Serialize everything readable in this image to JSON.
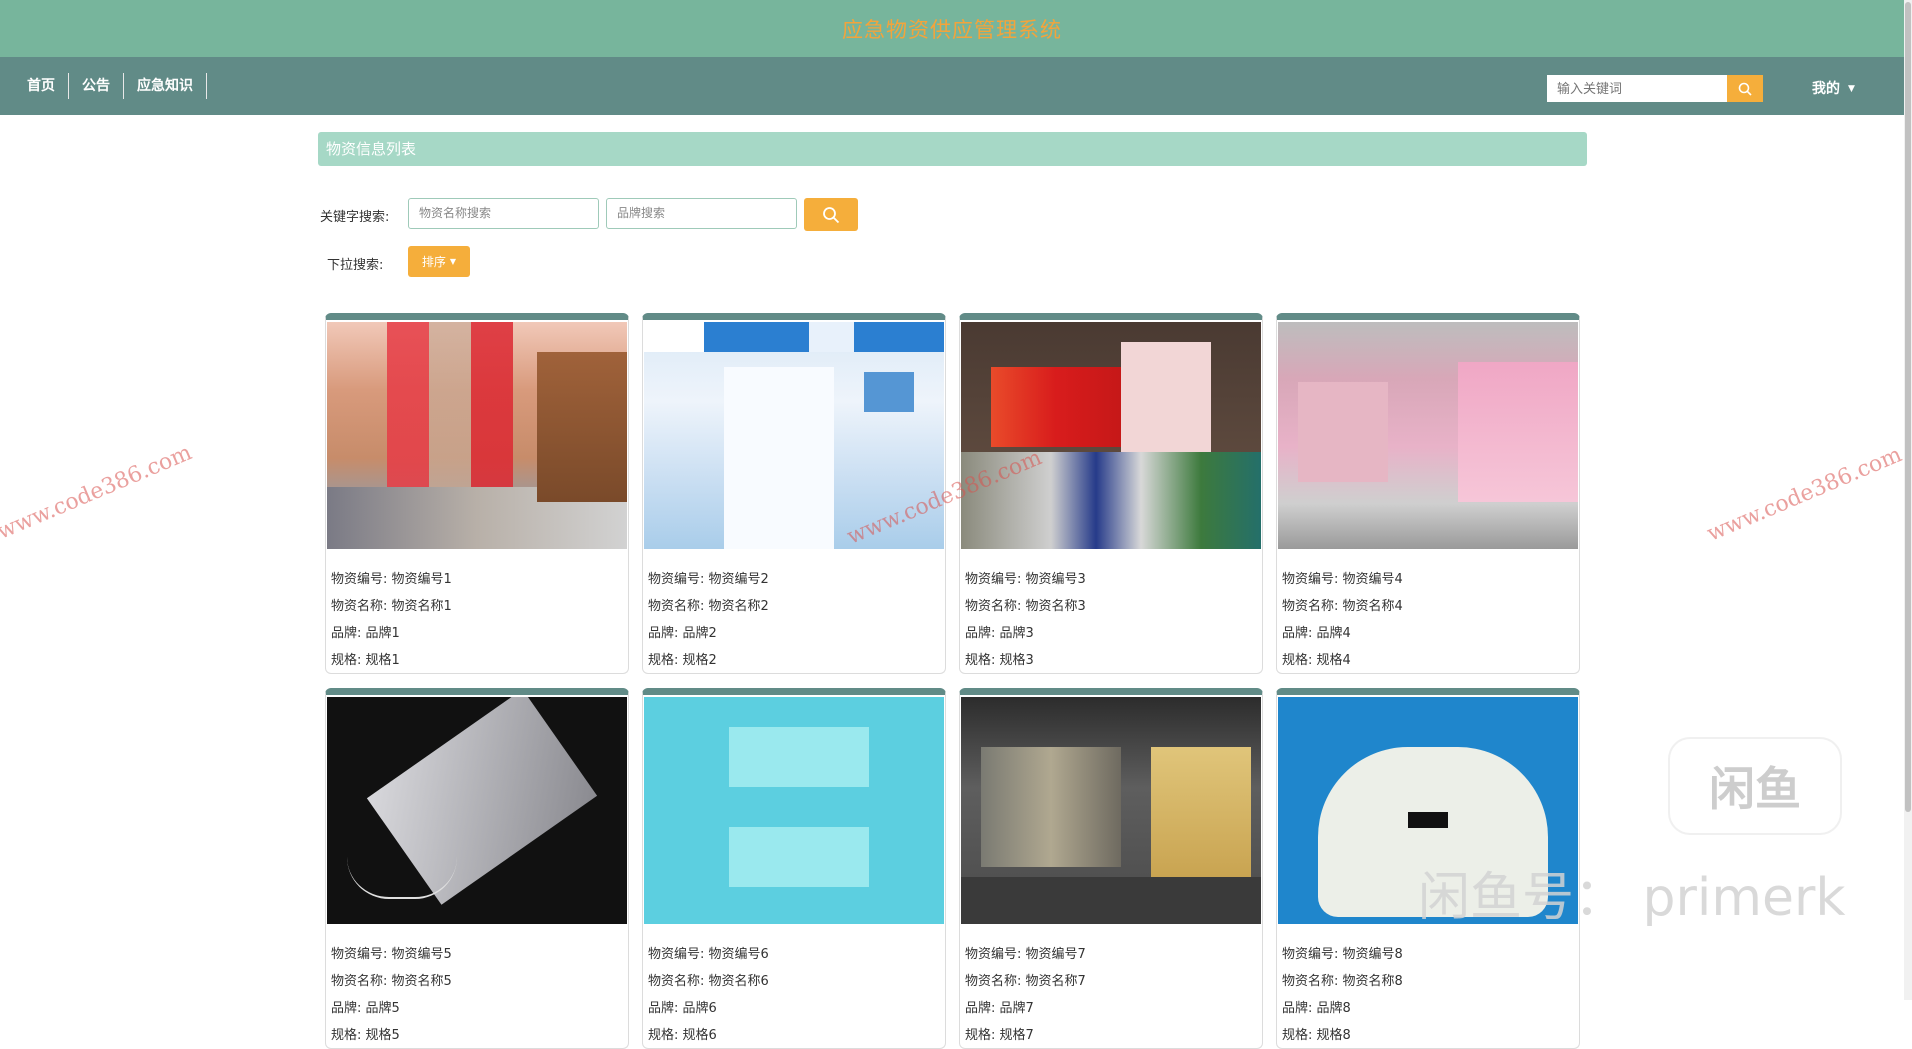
{
  "app_title": "应急物资供应管理系统",
  "nav": {
    "items": [
      "首页",
      "公告",
      "应急知识"
    ],
    "search_placeholder": "输入关键词",
    "account_label": "我的"
  },
  "section_title": "物资信息列表",
  "filters": {
    "keyword_label": "关键字搜索:",
    "name_placeholder": "物资名称搜索",
    "brand_placeholder": "品牌搜索",
    "dropdown_label": "下拉搜索:",
    "sort_label": "排序"
  },
  "items": [
    {
      "code_line": "物资编号: 物资编号1",
      "name_line": "物资名称: 物资名称1",
      "brand_line": "品牌: 品牌1",
      "spec_line": "规格: 规格1"
    },
    {
      "code_line": "物资编号: 物资编号2",
      "name_line": "物资名称: 物资名称2",
      "brand_line": "品牌: 品牌2",
      "spec_line": "规格: 规格2"
    },
    {
      "code_line": "物资编号: 物资编号3",
      "name_line": "物资名称: 物资名称3",
      "brand_line": "品牌: 品牌3",
      "spec_line": "规格: 规格3"
    },
    {
      "code_line": "物资编号: 物资编号4",
      "name_line": "物资名称: 物资名称4",
      "brand_line": "品牌: 品牌4",
      "spec_line": "规格: 规格4"
    },
    {
      "code_line": "物资编号: 物资编号5",
      "name_line": "物资名称: 物资名称5",
      "brand_line": "品牌: 品牌5",
      "spec_line": "规格: 规格5"
    },
    {
      "code_line": "物资编号: 物资编号6",
      "name_line": "物资名称: 物资名称6",
      "brand_line": "品牌: 品牌6",
      "spec_line": "规格: 规格6"
    },
    {
      "code_line": "物资编号: 物资编号7",
      "name_line": "物资名称: 物资名称7",
      "brand_line": "品牌: 品牌7",
      "spec_line": "规格: 规格7"
    },
    {
      "code_line": "物资编号: 物资编号8",
      "name_line": "物资名称: 物资名称8",
      "brand_line": "品牌: 品牌8",
      "spec_line": "规格: 规格8"
    }
  ],
  "watermarks": {
    "site": "www.code386.com",
    "xianyu_logo": "闲鱼",
    "xianyu_id": "闲鱼号： primerk"
  },
  "colors": {
    "title_bar": "#77b59c",
    "title_text": "#f3a43b",
    "nav_bar": "#618b87",
    "accent": "#f5ae3b",
    "section_head": "#a6d8c6"
  }
}
